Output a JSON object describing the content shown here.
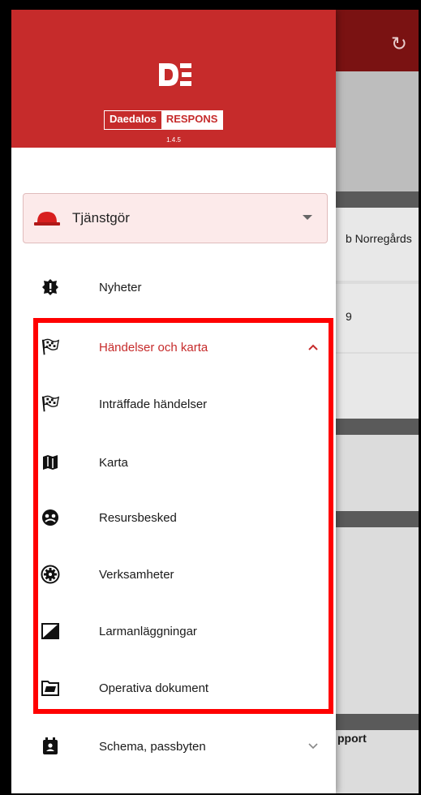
{
  "app": {
    "logo_text": "DE",
    "brand_name": "Daedalos",
    "brand_product": "RESPONS",
    "version": "1.4.5"
  },
  "status_selector": {
    "label": "Tjänstgör",
    "icon": "helmet-icon"
  },
  "background": {
    "partial_texts": [
      "b Norregårds",
      "9",
      "pport"
    ]
  },
  "menu": {
    "items": [
      {
        "label": "Nyheter",
        "icon": "alert-badge-icon"
      },
      {
        "label": "Händelser och karta",
        "icon": "checkered-flag-icon",
        "expanded": true
      },
      {
        "label": "Inträffade händelser",
        "icon": "checkered-flag-icon"
      },
      {
        "label": "Karta",
        "icon": "map-icon"
      },
      {
        "label": "Resursbesked",
        "icon": "resource-icon"
      },
      {
        "label": "Verksamheter",
        "icon": "gear-badge-icon"
      },
      {
        "label": "Larmanläggningar",
        "icon": "alarm-panel-icon"
      },
      {
        "label": "Operativa dokument",
        "icon": "folder-icon"
      },
      {
        "label": "Schema, passbyten",
        "icon": "calendar-person-icon",
        "expanded": false
      }
    ]
  },
  "colors": {
    "brand_red": "#c62b2b",
    "highlight_red": "#ff0000",
    "dark_header": "#7a1212"
  }
}
